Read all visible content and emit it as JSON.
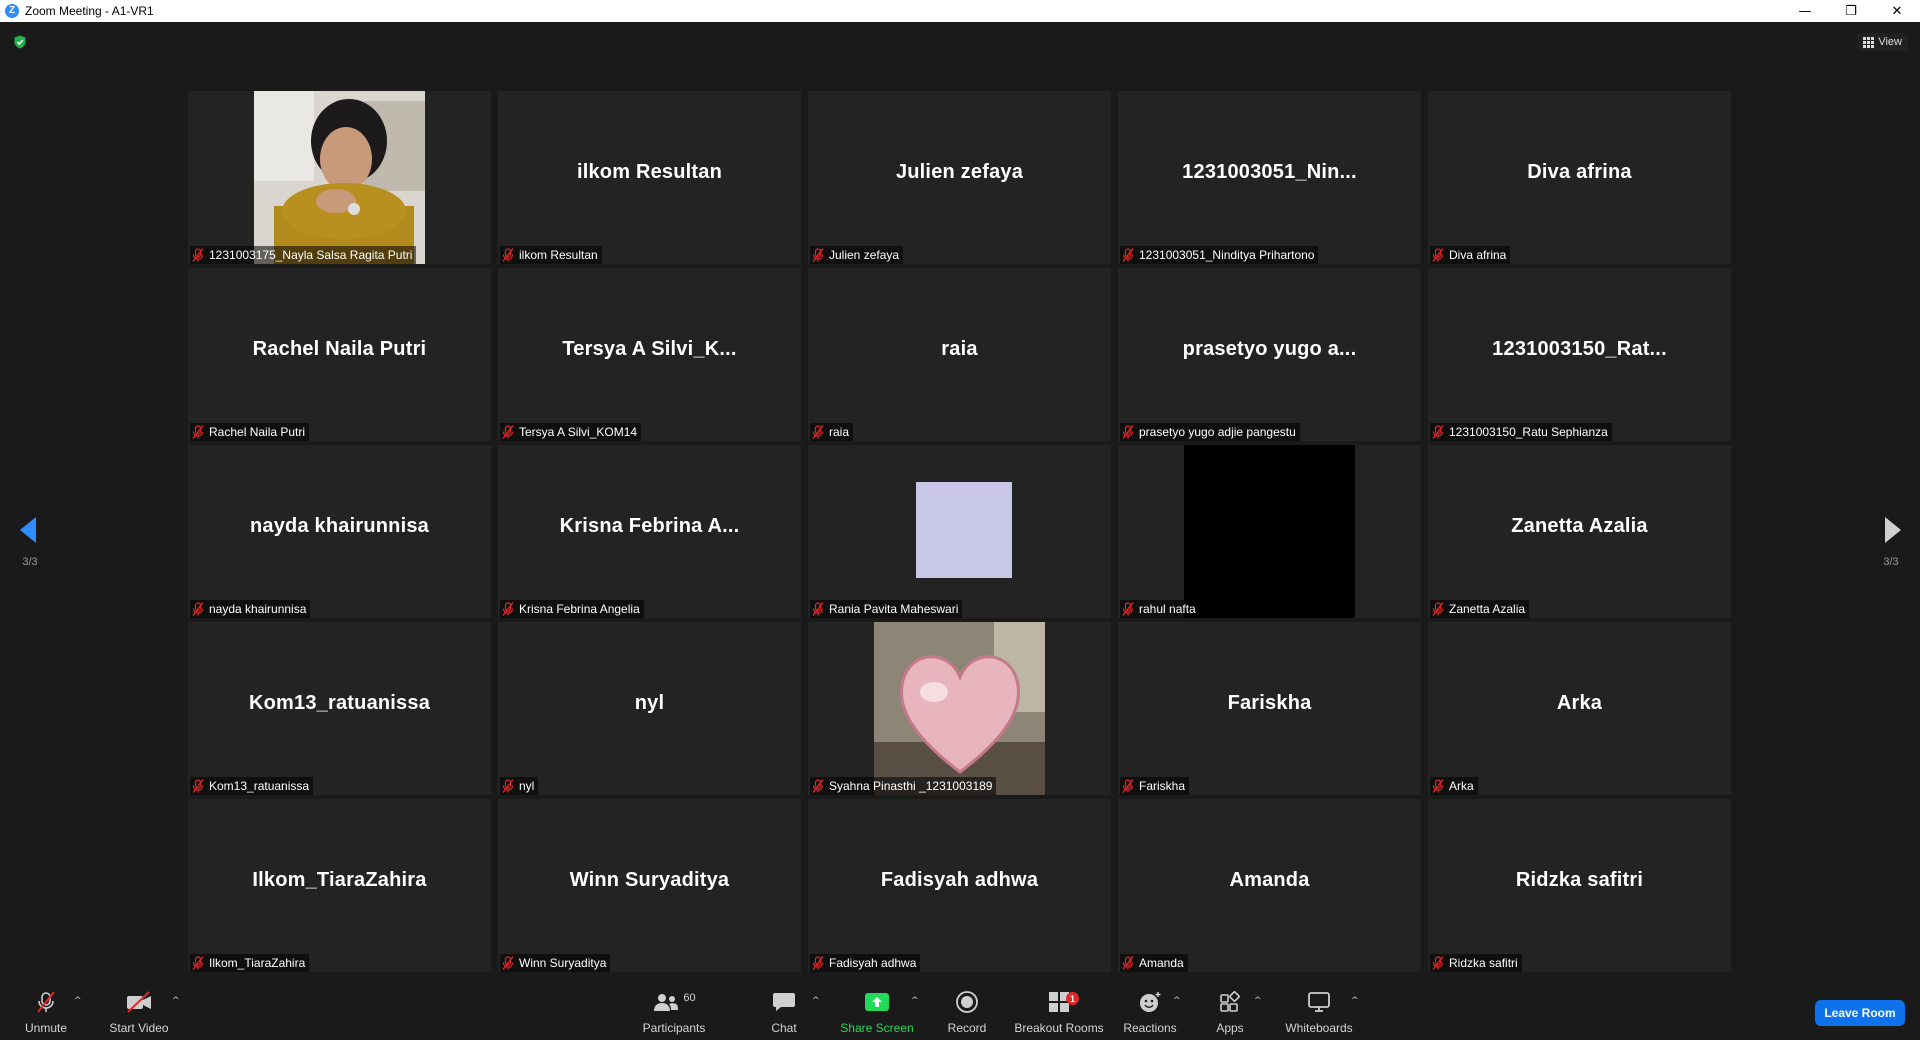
{
  "window": {
    "title": "Zoom Meeting - A1-VR1",
    "minimize": "—",
    "restore": "❐",
    "close": "✕"
  },
  "topbar": {
    "view_label": "View"
  },
  "pagination": {
    "left": "3/3",
    "right": "3/3"
  },
  "participants": [
    {
      "display": "",
      "label": "1231003175_Nayla Salsa Ragita Putri",
      "video": "photo-woman"
    },
    {
      "display": "ilkom Resultan",
      "label": "ilkom Resultan"
    },
    {
      "display": "Julien zefaya",
      "label": "Julien zefaya"
    },
    {
      "display": "1231003051_Nin...",
      "label": "1231003051_Ninditya Prihartono"
    },
    {
      "display": "Diva afrina",
      "label": "Diva afrina"
    },
    {
      "display": "Rachel Naila Putri",
      "label": "Rachel Naila Putri"
    },
    {
      "display": "Tersya A Silvi_K...",
      "label": "Tersya A Silvi_KOM14"
    },
    {
      "display": "raia",
      "label": "raia"
    },
    {
      "display": "prasetyo yugo a...",
      "label": "prasetyo yugo adjie pangestu"
    },
    {
      "display": "1231003150_Rat...",
      "label": "1231003150_Ratu Sephianza"
    },
    {
      "display": "nayda khairunnisa",
      "label": "nayda khairunnisa"
    },
    {
      "display": "Krisna Febrina A...",
      "label": "Krisna Febrina Angelia"
    },
    {
      "display": "",
      "label": "Rania Pavita Maheswari",
      "video": "lavender"
    },
    {
      "display": "",
      "label": "rahul nafta",
      "video": "black"
    },
    {
      "display": "Zanetta Azalia",
      "label": "Zanetta Azalia"
    },
    {
      "display": "Kom13_ratuanissa",
      "label": "Kom13_ratuanissa"
    },
    {
      "display": "nyl",
      "label": "nyl"
    },
    {
      "display": "",
      "label": "Syahna Pinasthi _1231003189",
      "video": "photo-heart"
    },
    {
      "display": "Fariskha",
      "label": "Fariskha"
    },
    {
      "display": "Arka",
      "label": "Arka"
    },
    {
      "display": "Ilkom_TiaraZahira",
      "label": "Ilkom_TiaraZahira"
    },
    {
      "display": "Winn Suryaditya",
      "label": "Winn Suryaditya"
    },
    {
      "display": "Fadisyah adhwa",
      "label": "Fadisyah adhwa"
    },
    {
      "display": "Amanda",
      "label": "Amanda"
    },
    {
      "display": "Ridzka safitri",
      "label": "Ridzka safitri"
    }
  ],
  "toolbar": {
    "unmute": "Unmute",
    "start_video": "Start Video",
    "participants": "Participants",
    "participants_count": "60",
    "chat": "Chat",
    "share_screen": "Share Screen",
    "record": "Record",
    "breakout_rooms": "Breakout Rooms",
    "breakout_badge": "1",
    "reactions": "Reactions",
    "apps": "Apps",
    "whiteboards": "Whiteboards",
    "leave": "Leave Room",
    "caret": "^"
  },
  "colors": {
    "background": "#1a1a1a",
    "tile": "#232323",
    "accent_blue": "#0e72ed",
    "share_green": "#23d959",
    "mic_red": "#e02828",
    "arrow_blue": "#2d8cff"
  }
}
